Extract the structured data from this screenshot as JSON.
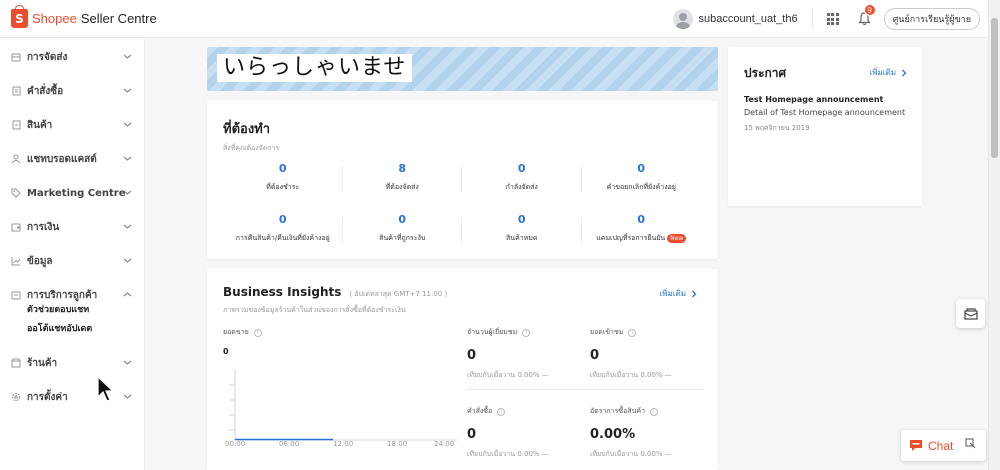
{
  "header": {
    "brand": "Shopee",
    "product": "Seller Centre",
    "username": "subaccount_uat_th6",
    "notification_count": "9",
    "learning_center": "ศูนย์การเรียนรู้ผู้ขาย"
  },
  "sidebar": {
    "items": [
      {
        "label": "การจัดส่ง",
        "icon": "shipping-icon"
      },
      {
        "label": "คำสั่งซื้อ",
        "icon": "order-icon"
      },
      {
        "label": "สินค้า",
        "icon": "product-icon"
      },
      {
        "label": "แชทบรอดแคสต์",
        "icon": "chat-broadcast-icon"
      },
      {
        "label": "Marketing Centre",
        "icon": "tag-icon"
      },
      {
        "label": "การเงิน",
        "icon": "wallet-icon"
      },
      {
        "label": "ข้อมูล",
        "icon": "chart-icon"
      },
      {
        "label": "การบริการลูกค้า",
        "icon": "customer-service-icon"
      },
      {
        "label": "ร้านค้า",
        "icon": "shop-icon"
      },
      {
        "label": "การตั้งค่า",
        "icon": "settings-icon"
      }
    ],
    "sub_items": [
      "ตัวช่วยตอบแชท",
      "ออโต้แชทอัปเดต"
    ]
  },
  "banner": {
    "text": "いらっしゃいませ"
  },
  "todo": {
    "title": "ที่ต้องทำ",
    "subtitle": "สิ่งที่คุณต้องจัดการ",
    "cells": [
      {
        "value": "0",
        "label": "ที่ต้องชำระ"
      },
      {
        "value": "8",
        "label": "ที่ต้องจัดส่ง"
      },
      {
        "value": "0",
        "label": "กำลังจัดส่ง"
      },
      {
        "value": "0",
        "label": "คำขอยกเลิกที่ยังค้างอยู่"
      },
      {
        "value": "0",
        "label": "การคืนสินค้า/คืนเงินที่ยังค้างอยู่"
      },
      {
        "value": "0",
        "label": "สินค้าที่ถูกระงับ"
      },
      {
        "value": "0",
        "label": "สินค้าหมด"
      },
      {
        "value": "0",
        "label": "แคมเปญที่รอการยืนยัน",
        "badge": "New"
      }
    ]
  },
  "insights": {
    "title": "Business Insights",
    "updated": "( อัปเดทล่าสุด GMT+7 11:00 )",
    "subtitle": "ภาพรวมของข้อมูลร้านค้าในส่วนของการสั่งซื้อที่ต้องชำระเงิน",
    "more": "เพิ่มเติม",
    "sales_label": "ยอดขาย",
    "sales_value": "0",
    "x_ticks": [
      "00:00",
      "06:00",
      "12:00",
      "18:00",
      "24:00"
    ],
    "metrics": [
      {
        "label": "จำนวนผู้เยี่ยมชม",
        "value": "0",
        "compare": "เทียบกับเมื่อวาน 0.00% —"
      },
      {
        "label": "ยอดเข้าชม",
        "value": "0",
        "compare": "เทียบกับเมื่อวาน 0.00% —"
      },
      {
        "label": "คำสั่งซื้อ",
        "value": "0",
        "compare": "เทียบกับเมื่อวาน 0.00% —"
      },
      {
        "label": "อัตราการซื้อสินค้า",
        "value": "0.00%",
        "compare": "เทียบกับเมื่อวาน 0.00% —"
      }
    ]
  },
  "announcement": {
    "title": "ประกาศ",
    "more": "เพิ่มเติม",
    "item_title": "Test Homepage announcement",
    "item_detail": "Detail of Test Homepage announcement",
    "item_date": "15 พฤศจิกายน 2019"
  },
  "chat": {
    "label": "Chat"
  },
  "colors": {
    "brand": "#ee4d2d",
    "link": "#2673dd"
  }
}
